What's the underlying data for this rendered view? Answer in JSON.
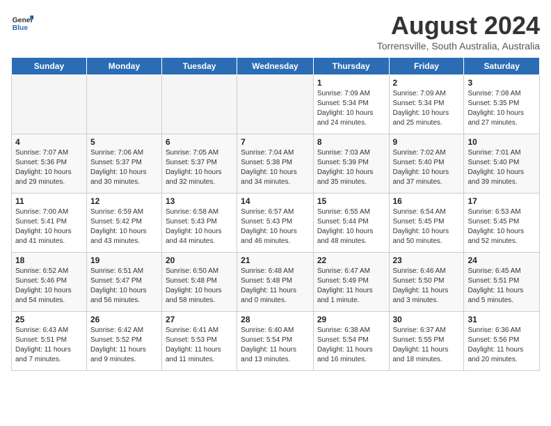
{
  "header": {
    "logo_line1": "General",
    "logo_line2": "Blue",
    "title": "August 2024",
    "subtitle": "Torrensville, South Australia, Australia"
  },
  "days_of_week": [
    "Sunday",
    "Monday",
    "Tuesday",
    "Wednesday",
    "Thursday",
    "Friday",
    "Saturday"
  ],
  "weeks": [
    [
      {
        "day": "",
        "info": ""
      },
      {
        "day": "",
        "info": ""
      },
      {
        "day": "",
        "info": ""
      },
      {
        "day": "",
        "info": ""
      },
      {
        "day": "1",
        "info": "Sunrise: 7:09 AM\nSunset: 5:34 PM\nDaylight: 10 hours\nand 24 minutes."
      },
      {
        "day": "2",
        "info": "Sunrise: 7:09 AM\nSunset: 5:34 PM\nDaylight: 10 hours\nand 25 minutes."
      },
      {
        "day": "3",
        "info": "Sunrise: 7:08 AM\nSunset: 5:35 PM\nDaylight: 10 hours\nand 27 minutes."
      }
    ],
    [
      {
        "day": "4",
        "info": "Sunrise: 7:07 AM\nSunset: 5:36 PM\nDaylight: 10 hours\nand 29 minutes."
      },
      {
        "day": "5",
        "info": "Sunrise: 7:06 AM\nSunset: 5:37 PM\nDaylight: 10 hours\nand 30 minutes."
      },
      {
        "day": "6",
        "info": "Sunrise: 7:05 AM\nSunset: 5:37 PM\nDaylight: 10 hours\nand 32 minutes."
      },
      {
        "day": "7",
        "info": "Sunrise: 7:04 AM\nSunset: 5:38 PM\nDaylight: 10 hours\nand 34 minutes."
      },
      {
        "day": "8",
        "info": "Sunrise: 7:03 AM\nSunset: 5:39 PM\nDaylight: 10 hours\nand 35 minutes."
      },
      {
        "day": "9",
        "info": "Sunrise: 7:02 AM\nSunset: 5:40 PM\nDaylight: 10 hours\nand 37 minutes."
      },
      {
        "day": "10",
        "info": "Sunrise: 7:01 AM\nSunset: 5:40 PM\nDaylight: 10 hours\nand 39 minutes."
      }
    ],
    [
      {
        "day": "11",
        "info": "Sunrise: 7:00 AM\nSunset: 5:41 PM\nDaylight: 10 hours\nand 41 minutes."
      },
      {
        "day": "12",
        "info": "Sunrise: 6:59 AM\nSunset: 5:42 PM\nDaylight: 10 hours\nand 43 minutes."
      },
      {
        "day": "13",
        "info": "Sunrise: 6:58 AM\nSunset: 5:43 PM\nDaylight: 10 hours\nand 44 minutes."
      },
      {
        "day": "14",
        "info": "Sunrise: 6:57 AM\nSunset: 5:43 PM\nDaylight: 10 hours\nand 46 minutes."
      },
      {
        "day": "15",
        "info": "Sunrise: 6:55 AM\nSunset: 5:44 PM\nDaylight: 10 hours\nand 48 minutes."
      },
      {
        "day": "16",
        "info": "Sunrise: 6:54 AM\nSunset: 5:45 PM\nDaylight: 10 hours\nand 50 minutes."
      },
      {
        "day": "17",
        "info": "Sunrise: 6:53 AM\nSunset: 5:45 PM\nDaylight: 10 hours\nand 52 minutes."
      }
    ],
    [
      {
        "day": "18",
        "info": "Sunrise: 6:52 AM\nSunset: 5:46 PM\nDaylight: 10 hours\nand 54 minutes."
      },
      {
        "day": "19",
        "info": "Sunrise: 6:51 AM\nSunset: 5:47 PM\nDaylight: 10 hours\nand 56 minutes."
      },
      {
        "day": "20",
        "info": "Sunrise: 6:50 AM\nSunset: 5:48 PM\nDaylight: 10 hours\nand 58 minutes."
      },
      {
        "day": "21",
        "info": "Sunrise: 6:48 AM\nSunset: 5:48 PM\nDaylight: 11 hours\nand 0 minutes."
      },
      {
        "day": "22",
        "info": "Sunrise: 6:47 AM\nSunset: 5:49 PM\nDaylight: 11 hours\nand 1 minute."
      },
      {
        "day": "23",
        "info": "Sunrise: 6:46 AM\nSunset: 5:50 PM\nDaylight: 11 hours\nand 3 minutes."
      },
      {
        "day": "24",
        "info": "Sunrise: 6:45 AM\nSunset: 5:51 PM\nDaylight: 11 hours\nand 5 minutes."
      }
    ],
    [
      {
        "day": "25",
        "info": "Sunrise: 6:43 AM\nSunset: 5:51 PM\nDaylight: 11 hours\nand 7 minutes."
      },
      {
        "day": "26",
        "info": "Sunrise: 6:42 AM\nSunset: 5:52 PM\nDaylight: 11 hours\nand 9 minutes."
      },
      {
        "day": "27",
        "info": "Sunrise: 6:41 AM\nSunset: 5:53 PM\nDaylight: 11 hours\nand 11 minutes."
      },
      {
        "day": "28",
        "info": "Sunrise: 6:40 AM\nSunset: 5:54 PM\nDaylight: 11 hours\nand 13 minutes."
      },
      {
        "day": "29",
        "info": "Sunrise: 6:38 AM\nSunset: 5:54 PM\nDaylight: 11 hours\nand 16 minutes."
      },
      {
        "day": "30",
        "info": "Sunrise: 6:37 AM\nSunset: 5:55 PM\nDaylight: 11 hours\nand 18 minutes."
      },
      {
        "day": "31",
        "info": "Sunrise: 6:36 AM\nSunset: 5:56 PM\nDaylight: 11 hours\nand 20 minutes."
      }
    ]
  ]
}
